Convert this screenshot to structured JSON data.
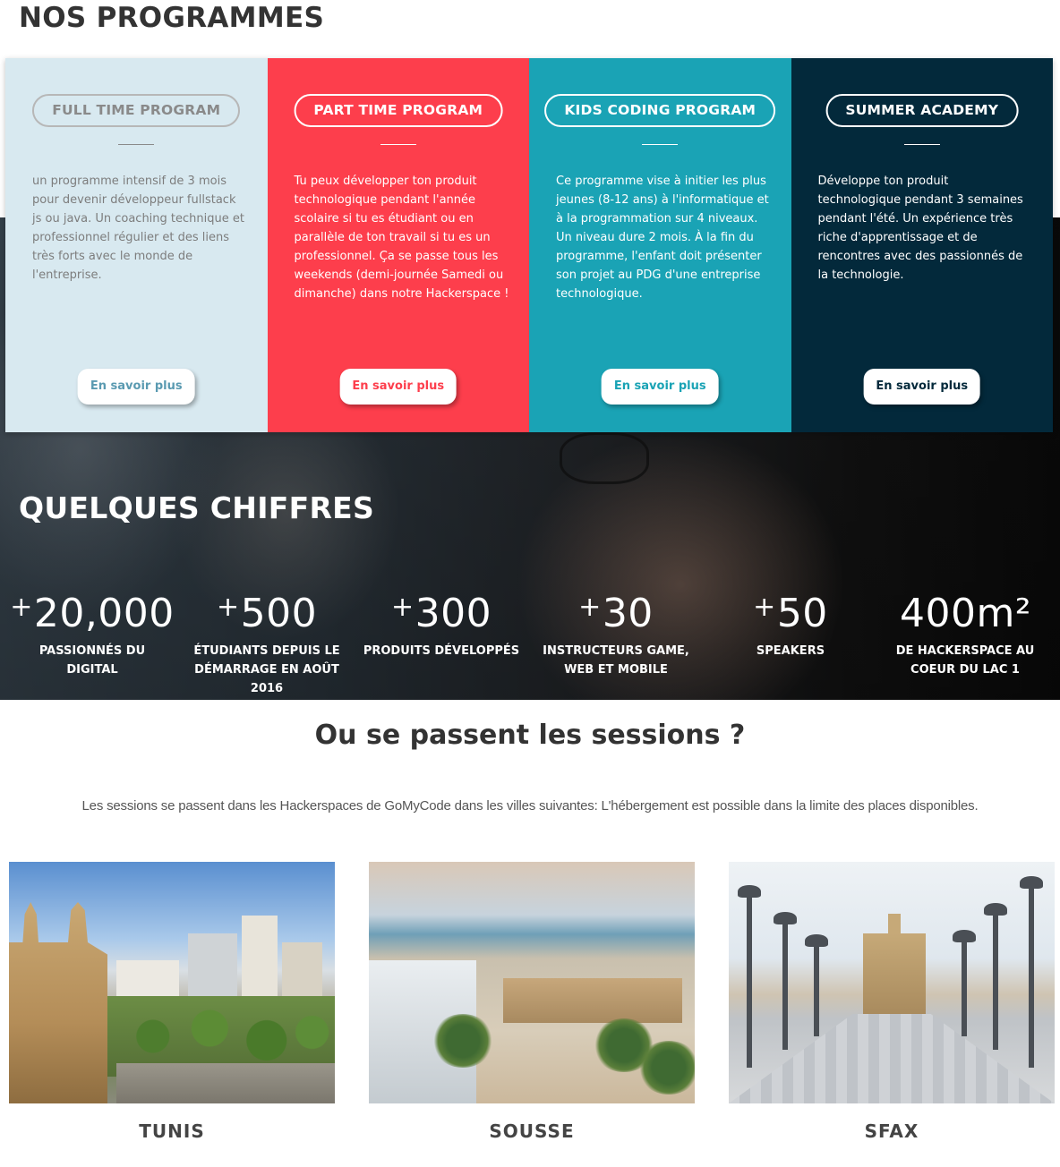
{
  "programs_section": {
    "title": "NOS PROGRAMMES"
  },
  "programs": [
    {
      "title": "FULL TIME PROGRAM",
      "description": "un programme intensif de 3 mois pour devenir développeur fullstack js ou java. Un coaching technique et professionnel régulier et des liens très forts avec le monde de l'entreprise.",
      "button": "En savoir plus"
    },
    {
      "title": "PART TIME PROGRAM",
      "description": "Tu peux développer ton produit technologique pendant l'année scolaire si tu es étudiant ou en parallèle de ton travail si tu es un professionnel. Ça se passe tous les weekends (demi-journée Samedi ou dimanche) dans notre Hackerspace !",
      "button": "En savoir plus"
    },
    {
      "title": "KIDS CODING PROGRAM",
      "description": "Ce programme vise à initier les plus jeunes (8-12 ans) à l'informatique et à la programmation sur 4 niveaux. Un niveau dure 2 mois. À la fin du programme, l'enfant doit présenter son projet au PDG d'une entreprise technologique.",
      "button": "En savoir plus"
    },
    {
      "title": "SUMMER ACADEMY",
      "description": "Développe ton produit technologique pendant 3 semaines pendant l'été. Un expérience très riche d'apprentissage et de rencontres avec des passionnés de la technologie.",
      "button": "En savoir plus"
    }
  ],
  "program_colors": [
    "#d8e9f0",
    "#fd3e4c",
    "#1aa3b5",
    "#03293b"
  ],
  "stats_section": {
    "title": "QUELQUES CHIFFRES"
  },
  "stats": [
    {
      "prefix": "+",
      "value": "20,000",
      "label": "PASSIONNÉS DU DIGITAL"
    },
    {
      "prefix": "+",
      "value": "500",
      "label": "ÉTUDIANTS DEPUIS LE DÉMARRAGE EN AOÛT 2016"
    },
    {
      "prefix": "+",
      "value": "300",
      "label": "PRODUITS DÉVELOPPÉS"
    },
    {
      "prefix": "+",
      "value": "30",
      "label": "INSTRUCTEURS GAME, WEB ET MOBILE"
    },
    {
      "prefix": "+",
      "value": "50",
      "label": "SPEAKERS"
    },
    {
      "prefix": "",
      "value": "400m²",
      "label": "DE HACKERSPACE AU COEUR DU LAC 1"
    }
  ],
  "sessions": {
    "title": "Ou se passent les sessions ?",
    "text": "Les sessions se passent dans les Hackerspaces de GoMyCode dans les villes suivantes: L'hébergement est possible dans la limite des places disponibles.",
    "cities": [
      {
        "name": "TUNIS"
      },
      {
        "name": "SOUSSE"
      },
      {
        "name": "SFAX"
      }
    ]
  }
}
